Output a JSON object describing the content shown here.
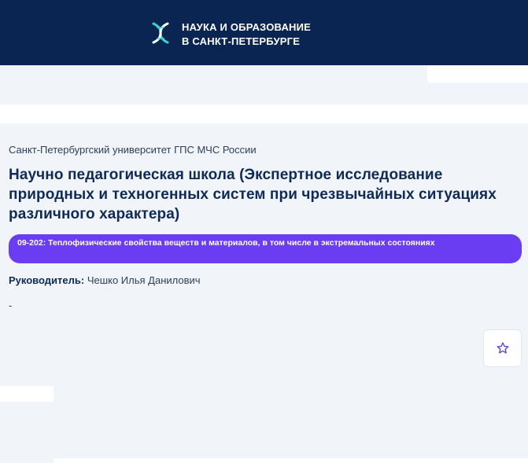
{
  "header": {
    "brand_line1": "НАУКА И ОБРАЗОВАНИЕ",
    "brand_line2": "В САНКТ-ПЕТЕРБУРГЕ",
    "logo_icon": "dna-icon",
    "accent_color": "#0b2552"
  },
  "card": {
    "university": "Санкт-Петербургский университет ГПС МЧС России",
    "title": "Научно педагогическая школа (Экспертное исследование природных и техногенных систем при чрезвычайных ситуациях различного характера)",
    "tag": "09-202: Теплофизические свойства веществ и материалов, в том числе в экстремальных состояниях",
    "tag_color": "#6a3df2",
    "leader_label": "Руководитель:",
    "leader_name": "Чешко Илья Данилович",
    "description": "-",
    "favorite_icon": "star-outline-icon"
  }
}
